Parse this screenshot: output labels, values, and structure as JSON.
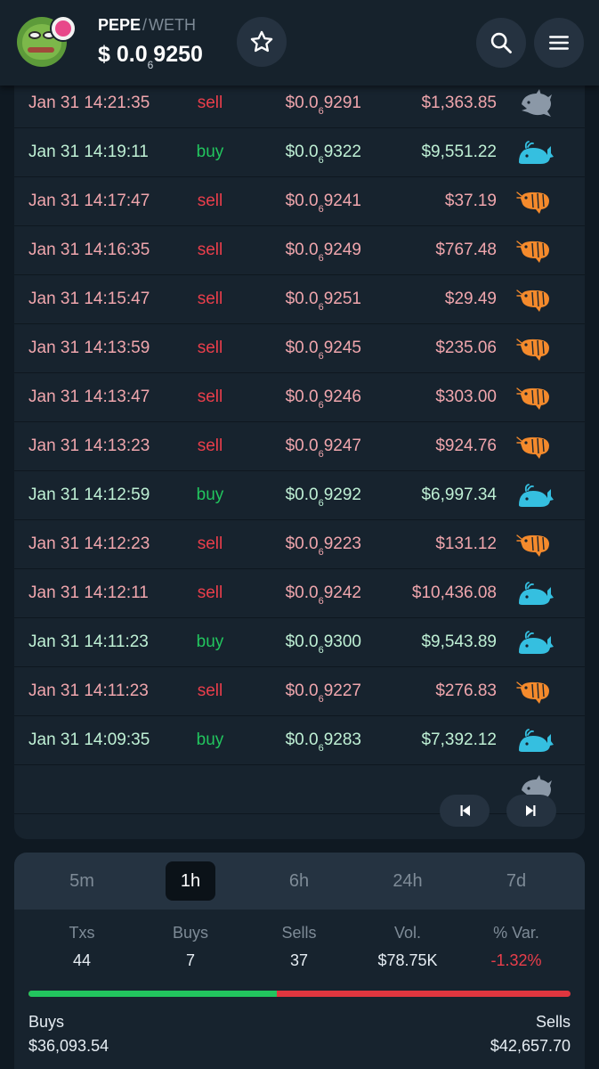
{
  "header": {
    "base": "PEPE",
    "separator": "/",
    "quote": "WETH",
    "price_prefix": "$ 0.0",
    "price_zeros": "6",
    "price_digits": "9250"
  },
  "colors": {
    "sell": "#ea3e4b",
    "buy": "#22c55e",
    "whale": "#35bfe0",
    "shrimp": "#f48a2c",
    "dolphin": "#8b98a7"
  },
  "trades": [
    {
      "date": "Jan 31 14:21:35",
      "side": "sell",
      "price_prefix": "$0.0",
      "zeros": "6",
      "price_digits": "9291",
      "amount": "$1,363.85",
      "icon": "dolphin-icon"
    },
    {
      "date": "Jan 31 14:19:11",
      "side": "buy",
      "price_prefix": "$0.0",
      "zeros": "6",
      "price_digits": "9322",
      "amount": "$9,551.22",
      "icon": "whale-icon"
    },
    {
      "date": "Jan 31 14:17:47",
      "side": "sell",
      "price_prefix": "$0.0",
      "zeros": "6",
      "price_digits": "9241",
      "amount": "$37.19",
      "icon": "shrimp-icon"
    },
    {
      "date": "Jan 31 14:16:35",
      "side": "sell",
      "price_prefix": "$0.0",
      "zeros": "6",
      "price_digits": "9249",
      "amount": "$767.48",
      "icon": "shrimp-icon"
    },
    {
      "date": "Jan 31 14:15:47",
      "side": "sell",
      "price_prefix": "$0.0",
      "zeros": "6",
      "price_digits": "9251",
      "amount": "$29.49",
      "icon": "shrimp-icon"
    },
    {
      "date": "Jan 31 14:13:59",
      "side": "sell",
      "price_prefix": "$0.0",
      "zeros": "6",
      "price_digits": "9245",
      "amount": "$235.06",
      "icon": "shrimp-icon"
    },
    {
      "date": "Jan 31 14:13:47",
      "side": "sell",
      "price_prefix": "$0.0",
      "zeros": "6",
      "price_digits": "9246",
      "amount": "$303.00",
      "icon": "shrimp-icon"
    },
    {
      "date": "Jan 31 14:13:23",
      "side": "sell",
      "price_prefix": "$0.0",
      "zeros": "6",
      "price_digits": "9247",
      "amount": "$924.76",
      "icon": "shrimp-icon"
    },
    {
      "date": "Jan 31 14:12:59",
      "side": "buy",
      "price_prefix": "$0.0",
      "zeros": "6",
      "price_digits": "9292",
      "amount": "$6,997.34",
      "icon": "whale-icon"
    },
    {
      "date": "Jan 31 14:12:23",
      "side": "sell",
      "price_prefix": "$0.0",
      "zeros": "6",
      "price_digits": "9223",
      "amount": "$131.12",
      "icon": "shrimp-icon"
    },
    {
      "date": "Jan 31 14:12:11",
      "side": "sell",
      "price_prefix": "$0.0",
      "zeros": "6",
      "price_digits": "9242",
      "amount": "$10,436.08",
      "icon": "whale-icon"
    },
    {
      "date": "Jan 31 14:11:23",
      "side": "buy",
      "price_prefix": "$0.0",
      "zeros": "6",
      "price_digits": "9300",
      "amount": "$9,543.89",
      "icon": "whale-icon"
    },
    {
      "date": "Jan 31 14:11:23",
      "side": "sell",
      "price_prefix": "$0.0",
      "zeros": "6",
      "price_digits": "9227",
      "amount": "$276.83",
      "icon": "shrimp-icon"
    },
    {
      "date": "Jan 31 14:09:35",
      "side": "buy",
      "price_prefix": "$0.0",
      "zeros": "6",
      "price_digits": "9283",
      "amount": "$7,392.12",
      "icon": "whale-icon"
    }
  ],
  "timeframes": {
    "tabs": [
      "5m",
      "1h",
      "6h",
      "24h",
      "7d"
    ],
    "active": "1h"
  },
  "stats": {
    "txs_label": "Txs",
    "txs": "44",
    "buys_label": "Buys",
    "buys": "7",
    "sells_label": "Sells",
    "sells": "37",
    "vol_label": "Vol.",
    "vol": "$78.75K",
    "var_label": "% Var.",
    "var": "-1.32%"
  },
  "totals": {
    "buys_label": "Buys",
    "buys_value": "$36,093.54",
    "sells_label": "Sells",
    "sells_value": "$42,657.70",
    "buy_share": 0.458
  }
}
